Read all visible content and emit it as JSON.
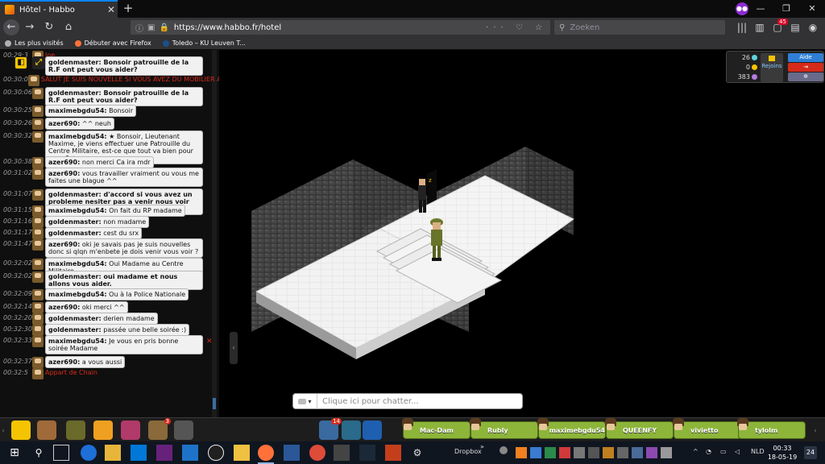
{
  "browser": {
    "tab_title": "Hôtel - Habbo",
    "tab_close": "✕",
    "new_tab": "+",
    "url": "https://www.habbo.fr/hotel",
    "search_placeholder": "Zoeken",
    "toolbar_badge": "45",
    "bookmarks": [
      "Les plus visités",
      "Débuter avec Firefox",
      "Toledo – KU Leuven T..."
    ],
    "window_controls": [
      "—",
      "❐",
      "✕"
    ]
  },
  "chat": {
    "messages": [
      {
        "time": "00:29:3",
        "user": "",
        "text": "Joe",
        "style": "red"
      },
      {
        "time": "",
        "user": "goldenmaster:",
        "text": "Bonsoir patrouille de la R.F ont peut vous aider?",
        "style": "bold"
      },
      {
        "time": "00:30:0",
        "user": "",
        "text": "SALUT JE SUIS NOUVELLE SI VOUS AVEZ DU MOBILIER A D",
        "style": "red"
      },
      {
        "time": "00:30:06",
        "user": "goldenmaster:",
        "text": "Bonsoir patrouille de la R.F ont peut vous aider?",
        "style": "bold"
      },
      {
        "time": "00:30:25",
        "user": "maximebgdu54:",
        "text": "Bonsoir",
        "style": "normal"
      },
      {
        "time": "00:30:26",
        "user": "azer690:",
        "text": "^^ neuh",
        "style": "normal"
      },
      {
        "time": "00:30:32",
        "user": "maximebgdu54:",
        "text": "★ Bonsoir, Lieutenant Maxime, je viens effectuer une Patrouille du Centre Militaire, est-ce que tout va bien pour vous ? ★",
        "style": "normal"
      },
      {
        "time": "00:30:38",
        "user": "azer690:",
        "text": "non merci Ca ira mdr",
        "style": "normal"
      },
      {
        "time": "00:31:02",
        "user": "azer690:",
        "text": "vous travailler vraiment ou vous me faites une blague ^^",
        "style": "normal"
      },
      {
        "time": "00:31:07",
        "user": "goldenmaster:",
        "text": "d'accord si vous avez un probleme nesiter pas a venir nous voir \"R.F Centre militaire\"",
        "style": "bold"
      },
      {
        "time": "00:31:15",
        "user": "maximebgdu54:",
        "text": "On fait du RP madame",
        "style": "normal"
      },
      {
        "time": "00:31:16",
        "user": "goldenmaster:",
        "text": "non madame",
        "style": "normal"
      },
      {
        "time": "00:31:17",
        "user": "goldenmaster:",
        "text": "cest du srx",
        "style": "normal"
      },
      {
        "time": "00:31:47",
        "user": "azer690:",
        "text": "oki je savais pas je suis nouvelles donc si qlqn m'enbete je dois venir vous voir ?",
        "style": "normal"
      },
      {
        "time": "00:32:02",
        "user": "maximebgdu54:",
        "text": "Oui Madame au Centre Militaire",
        "style": "normal"
      },
      {
        "time": "00:32:02",
        "user": "goldenmaster:",
        "text": "oui madame et nous allons vous aider.",
        "style": "bold"
      },
      {
        "time": "00:32:09",
        "user": "maximebgdu54:",
        "text": "Ou à la Police Nationale",
        "style": "normal"
      },
      {
        "time": "00:32:14",
        "user": "azer690:",
        "text": "oki merci ^^",
        "style": "normal"
      },
      {
        "time": "00:32:20",
        "user": "goldenmaster:",
        "text": "derien madame",
        "style": "normal"
      },
      {
        "time": "00:32:30",
        "user": "goldenmaster:",
        "text": "passée une belle soirée :)",
        "style": "normal"
      },
      {
        "time": "00:32:33",
        "user": "maximebgdu54:",
        "text": "Je vous en pris bonne soirée Madame",
        "style": "normal"
      },
      {
        "time": "00:32:37",
        "user": "azer690:",
        "text": "a vous aussi",
        "style": "normal"
      },
      {
        "time": "00:32:5",
        "user": "",
        "text": "Appart de Chain",
        "style": "red"
      }
    ]
  },
  "hud": {
    "diamonds": "26",
    "credits": "0",
    "duckets": "383",
    "join_label": "Rejoins",
    "help_label": "Aide",
    "colors": {
      "diamond": "#5fd3e0",
      "credit": "#f5c400",
      "ducket": "#b57be0",
      "help": "#2f7fd6",
      "exit": "#d62a1a",
      "settings": "#6a6a8a"
    }
  },
  "chat_input": {
    "placeholder": "Clique ici pour chatter...",
    "style_icon": "▾"
  },
  "toolbar": {
    "badges": {
      "navigator": "3",
      "shop": "14"
    },
    "friends": [
      "Mac-Dam",
      "Rubly",
      "maximebgdu54",
      "QUEENFY",
      "vivietto",
      "tylolm"
    ]
  },
  "taskbar": {
    "search_icon": "⚲",
    "dropbox": "Dropbox",
    "language": "NLD",
    "time": "00:33",
    "date": "18-05-19",
    "notifications": "24"
  }
}
